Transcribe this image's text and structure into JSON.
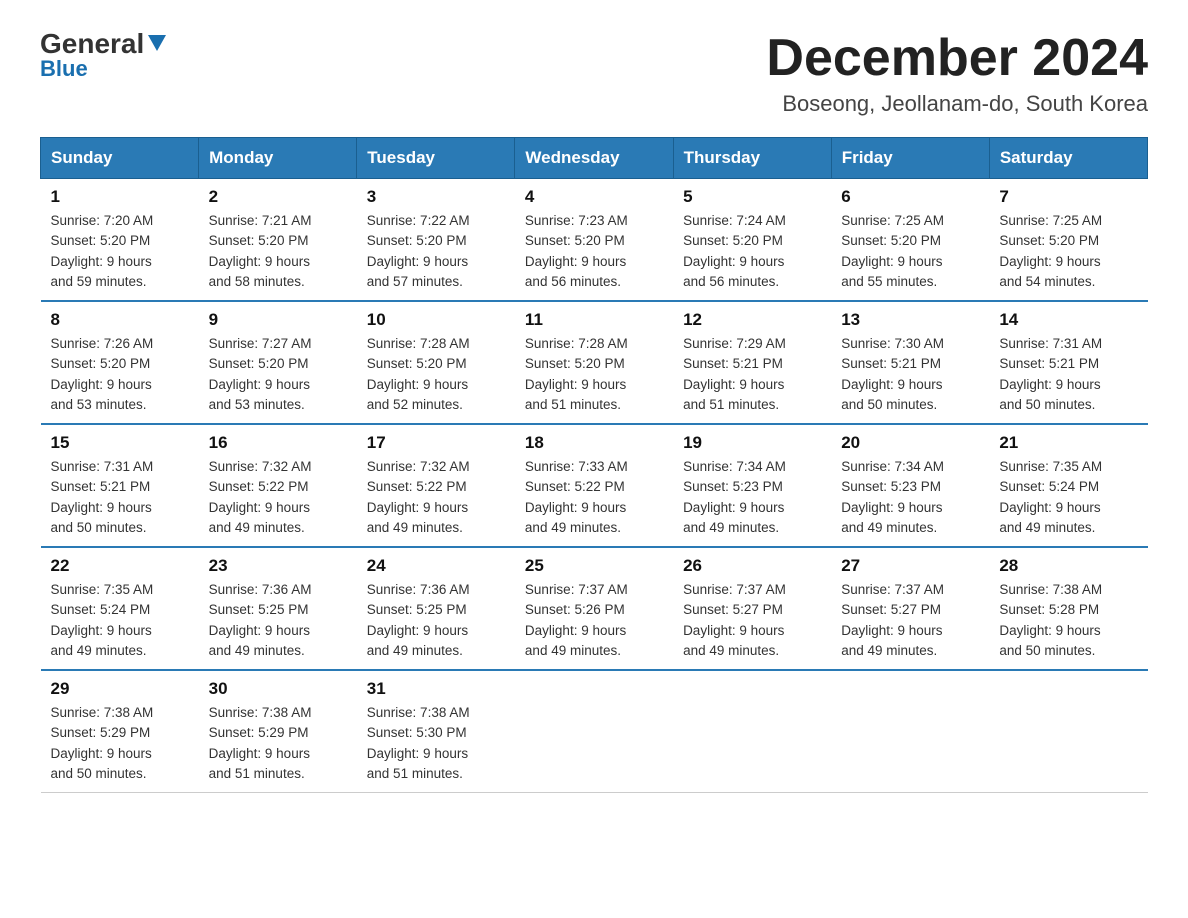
{
  "header": {
    "logo_general": "General",
    "logo_blue": "Blue",
    "title": "December 2024",
    "subtitle": "Boseong, Jeollanam-do, South Korea"
  },
  "days_of_week": [
    "Sunday",
    "Monday",
    "Tuesday",
    "Wednesday",
    "Thursday",
    "Friday",
    "Saturday"
  ],
  "weeks": [
    [
      {
        "day": "1",
        "sunrise": "7:20 AM",
        "sunset": "5:20 PM",
        "daylight": "9 hours and 59 minutes."
      },
      {
        "day": "2",
        "sunrise": "7:21 AM",
        "sunset": "5:20 PM",
        "daylight": "9 hours and 58 minutes."
      },
      {
        "day": "3",
        "sunrise": "7:22 AM",
        "sunset": "5:20 PM",
        "daylight": "9 hours and 57 minutes."
      },
      {
        "day": "4",
        "sunrise": "7:23 AM",
        "sunset": "5:20 PM",
        "daylight": "9 hours and 56 minutes."
      },
      {
        "day": "5",
        "sunrise": "7:24 AM",
        "sunset": "5:20 PM",
        "daylight": "9 hours and 56 minutes."
      },
      {
        "day": "6",
        "sunrise": "7:25 AM",
        "sunset": "5:20 PM",
        "daylight": "9 hours and 55 minutes."
      },
      {
        "day": "7",
        "sunrise": "7:25 AM",
        "sunset": "5:20 PM",
        "daylight": "9 hours and 54 minutes."
      }
    ],
    [
      {
        "day": "8",
        "sunrise": "7:26 AM",
        "sunset": "5:20 PM",
        "daylight": "9 hours and 53 minutes."
      },
      {
        "day": "9",
        "sunrise": "7:27 AM",
        "sunset": "5:20 PM",
        "daylight": "9 hours and 53 minutes."
      },
      {
        "day": "10",
        "sunrise": "7:28 AM",
        "sunset": "5:20 PM",
        "daylight": "9 hours and 52 minutes."
      },
      {
        "day": "11",
        "sunrise": "7:28 AM",
        "sunset": "5:20 PM",
        "daylight": "9 hours and 51 minutes."
      },
      {
        "day": "12",
        "sunrise": "7:29 AM",
        "sunset": "5:21 PM",
        "daylight": "9 hours and 51 minutes."
      },
      {
        "day": "13",
        "sunrise": "7:30 AM",
        "sunset": "5:21 PM",
        "daylight": "9 hours and 50 minutes."
      },
      {
        "day": "14",
        "sunrise": "7:31 AM",
        "sunset": "5:21 PM",
        "daylight": "9 hours and 50 minutes."
      }
    ],
    [
      {
        "day": "15",
        "sunrise": "7:31 AM",
        "sunset": "5:21 PM",
        "daylight": "9 hours and 50 minutes."
      },
      {
        "day": "16",
        "sunrise": "7:32 AM",
        "sunset": "5:22 PM",
        "daylight": "9 hours and 49 minutes."
      },
      {
        "day": "17",
        "sunrise": "7:32 AM",
        "sunset": "5:22 PM",
        "daylight": "9 hours and 49 minutes."
      },
      {
        "day": "18",
        "sunrise": "7:33 AM",
        "sunset": "5:22 PM",
        "daylight": "9 hours and 49 minutes."
      },
      {
        "day": "19",
        "sunrise": "7:34 AM",
        "sunset": "5:23 PM",
        "daylight": "9 hours and 49 minutes."
      },
      {
        "day": "20",
        "sunrise": "7:34 AM",
        "sunset": "5:23 PM",
        "daylight": "9 hours and 49 minutes."
      },
      {
        "day": "21",
        "sunrise": "7:35 AM",
        "sunset": "5:24 PM",
        "daylight": "9 hours and 49 minutes."
      }
    ],
    [
      {
        "day": "22",
        "sunrise": "7:35 AM",
        "sunset": "5:24 PM",
        "daylight": "9 hours and 49 minutes."
      },
      {
        "day": "23",
        "sunrise": "7:36 AM",
        "sunset": "5:25 PM",
        "daylight": "9 hours and 49 minutes."
      },
      {
        "day": "24",
        "sunrise": "7:36 AM",
        "sunset": "5:25 PM",
        "daylight": "9 hours and 49 minutes."
      },
      {
        "day": "25",
        "sunrise": "7:37 AM",
        "sunset": "5:26 PM",
        "daylight": "9 hours and 49 minutes."
      },
      {
        "day": "26",
        "sunrise": "7:37 AM",
        "sunset": "5:27 PM",
        "daylight": "9 hours and 49 minutes."
      },
      {
        "day": "27",
        "sunrise": "7:37 AM",
        "sunset": "5:27 PM",
        "daylight": "9 hours and 49 minutes."
      },
      {
        "day": "28",
        "sunrise": "7:38 AM",
        "sunset": "5:28 PM",
        "daylight": "9 hours and 50 minutes."
      }
    ],
    [
      {
        "day": "29",
        "sunrise": "7:38 AM",
        "sunset": "5:29 PM",
        "daylight": "9 hours and 50 minutes."
      },
      {
        "day": "30",
        "sunrise": "7:38 AM",
        "sunset": "5:29 PM",
        "daylight": "9 hours and 51 minutes."
      },
      {
        "day": "31",
        "sunrise": "7:38 AM",
        "sunset": "5:30 PM",
        "daylight": "9 hours and 51 minutes."
      },
      null,
      null,
      null,
      null
    ]
  ],
  "labels": {
    "sunrise": "Sunrise:",
    "sunset": "Sunset:",
    "daylight": "Daylight:"
  }
}
